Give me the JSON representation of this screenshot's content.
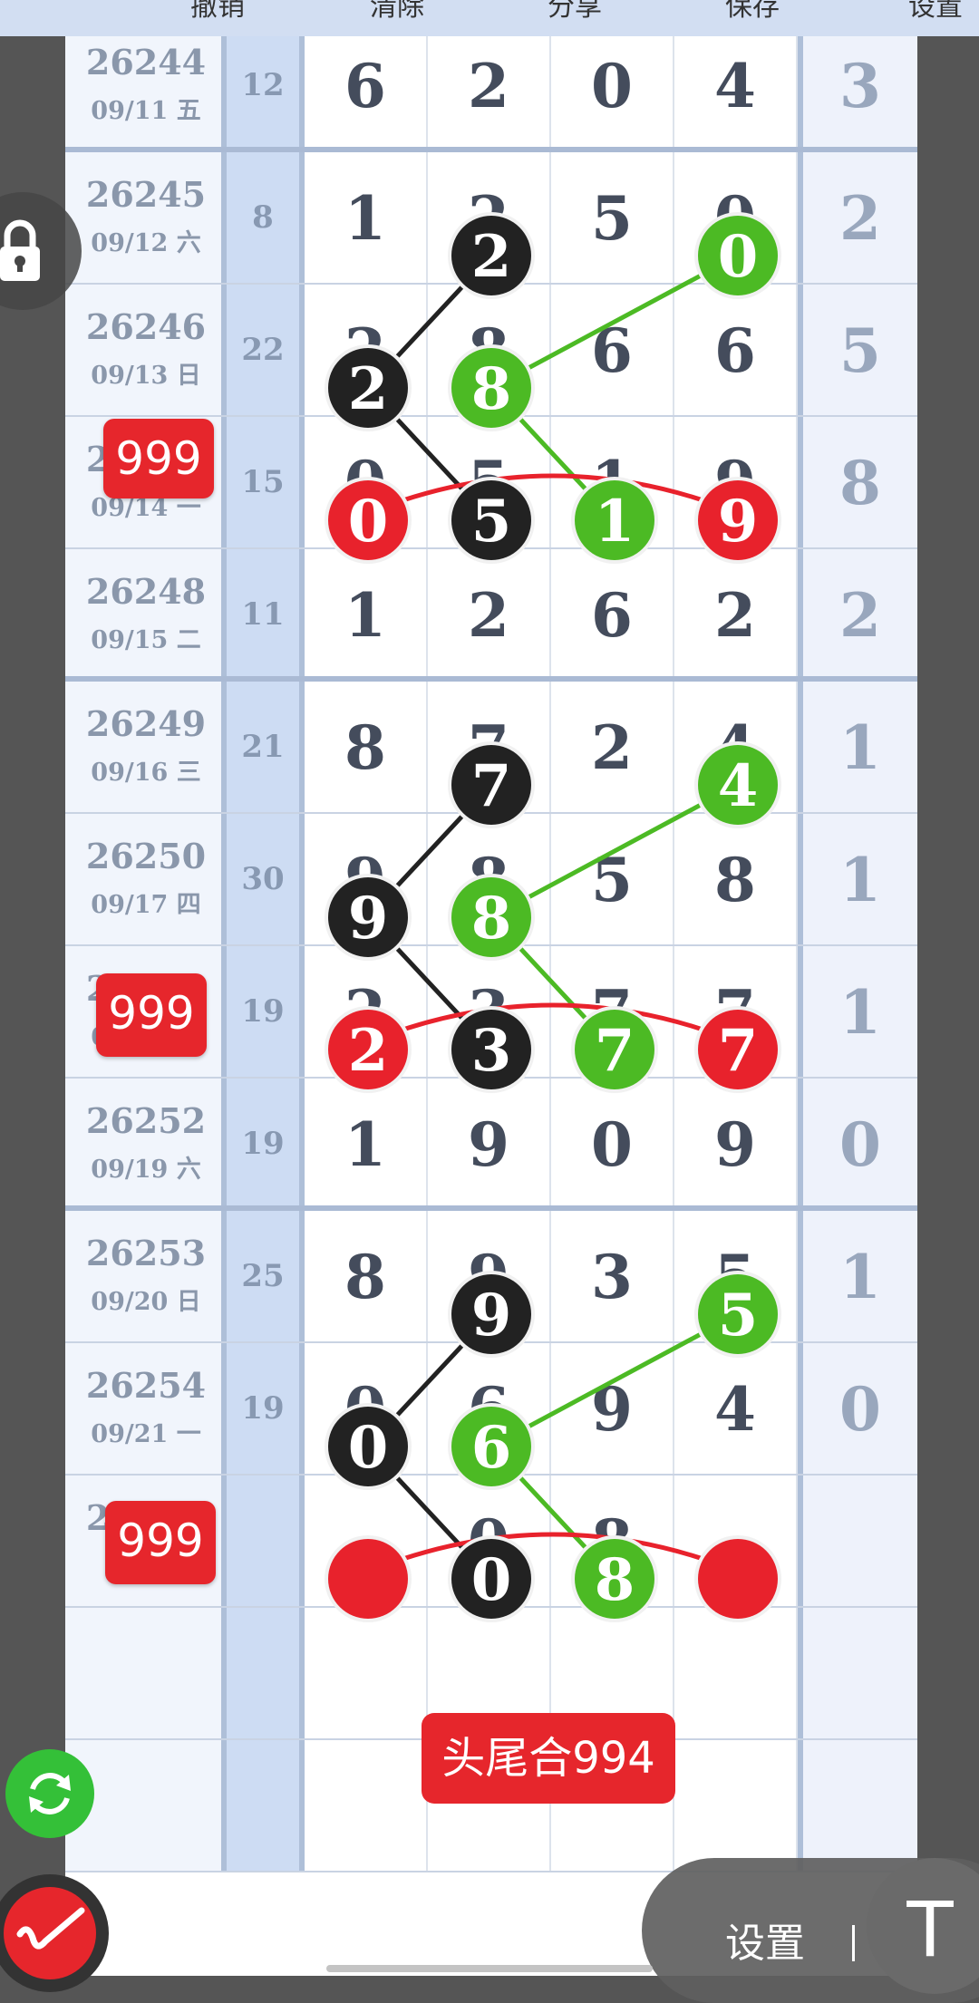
{
  "toolbar": {
    "undo_label": "撤销",
    "clear_label": "清除",
    "share_label": "分享",
    "save_label": "保存",
    "settings_label": "设置"
  },
  "rows": [
    {
      "issue": "26244",
      "date": "09/11 五",
      "sum": "12",
      "digits": [
        "6",
        "2",
        "0",
        "4"
      ],
      "total": "3"
    },
    {
      "issue": "26245",
      "date": "09/12 六",
      "sum": "8",
      "digits": [
        "1",
        "2",
        "5",
        "0"
      ],
      "total": "2"
    },
    {
      "issue": "26246",
      "date": "09/13 日",
      "sum": "22",
      "digits": [
        "2",
        "8",
        "6",
        "6"
      ],
      "total": "5"
    },
    {
      "issue": "26247",
      "date": "09/14 一",
      "sum": "15",
      "digits": [
        "0",
        "5",
        "1",
        "9"
      ],
      "total": "8"
    },
    {
      "issue": "26248",
      "date": "09/15 二",
      "sum": "11",
      "digits": [
        "1",
        "2",
        "6",
        "2"
      ],
      "total": "2"
    },
    {
      "issue": "26249",
      "date": "09/16 三",
      "sum": "21",
      "digits": [
        "8",
        "7",
        "2",
        "4"
      ],
      "total": "1"
    },
    {
      "issue": "26250",
      "date": "09/17 四",
      "sum": "30",
      "digits": [
        "9",
        "8",
        "5",
        "8"
      ],
      "total": "1"
    },
    {
      "issue": "26251",
      "date": "09/18 五",
      "sum": "19",
      "digits": [
        "2",
        "3",
        "7",
        "7"
      ],
      "total": "1"
    },
    {
      "issue": "26252",
      "date": "09/19 六",
      "sum": "19",
      "digits": [
        "1",
        "9",
        "0",
        "9"
      ],
      "total": "0"
    },
    {
      "issue": "26253",
      "date": "09/20 日",
      "sum": "25",
      "digits": [
        "8",
        "9",
        "3",
        "5"
      ],
      "total": "1"
    },
    {
      "issue": "26254",
      "date": "09/21 一",
      "sum": "19",
      "digits": [
        "0",
        "6",
        "9",
        "4"
      ],
      "total": "0"
    },
    {
      "issue": "26255",
      "date": "",
      "sum": "",
      "digits": [
        "",
        "0",
        "8",
        ""
      ],
      "total": ""
    },
    {
      "issue": "",
      "date": "",
      "sum": "",
      "digits": [
        "",
        "",
        "",
        ""
      ],
      "total": ""
    },
    {
      "issue": "",
      "date": "",
      "sum": "",
      "digits": [
        "",
        "",
        "",
        ""
      ],
      "total": ""
    }
  ],
  "badges": [
    "999",
    "999",
    "999"
  ],
  "result_badge": "头尾合994",
  "settings_bar": {
    "label": "设置",
    "text_tool_icon": "T"
  },
  "icons": {
    "lock": "lock-icon",
    "refresh": "refresh-icon",
    "pen": "pen-icon",
    "text_tool": "text-icon"
  },
  "colors": {
    "black_ball": "#222222",
    "green_ball": "#4cba24",
    "red_ball": "#e8222c",
    "badge_red": "#e6262c",
    "header_bg": "#d2def2"
  }
}
